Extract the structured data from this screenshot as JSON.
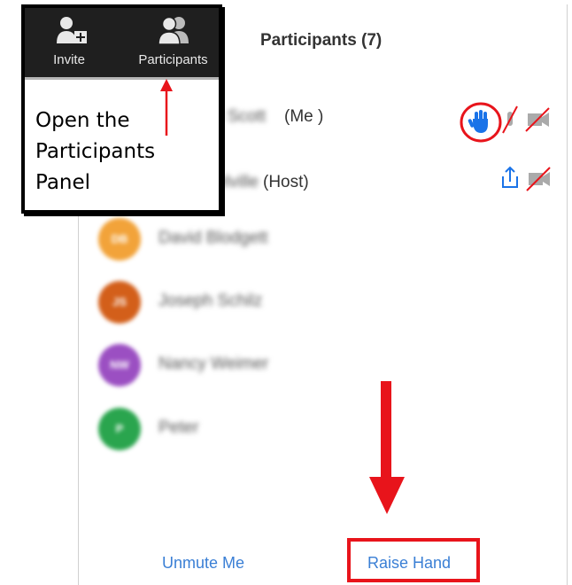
{
  "panel": {
    "title": "Participants (7)",
    "participants": [
      {
        "name": "Trudi Scott",
        "suffix": "(Me )",
        "initials": ""
      },
      {
        "name": "Liz Melville",
        "suffix": "(Host)",
        "initials": ""
      },
      {
        "name": "David Blodgett",
        "initials": "DB",
        "color": "#f2a33a"
      },
      {
        "name": "Joseph Schilz",
        "initials": "JS",
        "color": "#d35f1a"
      },
      {
        "name": "Nancy Weimer",
        "initials": "NW",
        "color": "#9b4fc2"
      },
      {
        "name": "Peter",
        "initials": "P",
        "color": "#2aa54e"
      }
    ],
    "unmute_label": "Unmute Me",
    "raise_hand_label": "Raise Hand"
  },
  "toolbar": {
    "invite_label": "Invite",
    "participants_label": "Participants"
  },
  "callout": {
    "line1": "Open the",
    "line2": "Participants",
    "line3": "Panel"
  },
  "colors": {
    "accent_red": "#e8141b",
    "link_blue": "#3a7fd5",
    "icon_blue": "#1a73e8"
  }
}
